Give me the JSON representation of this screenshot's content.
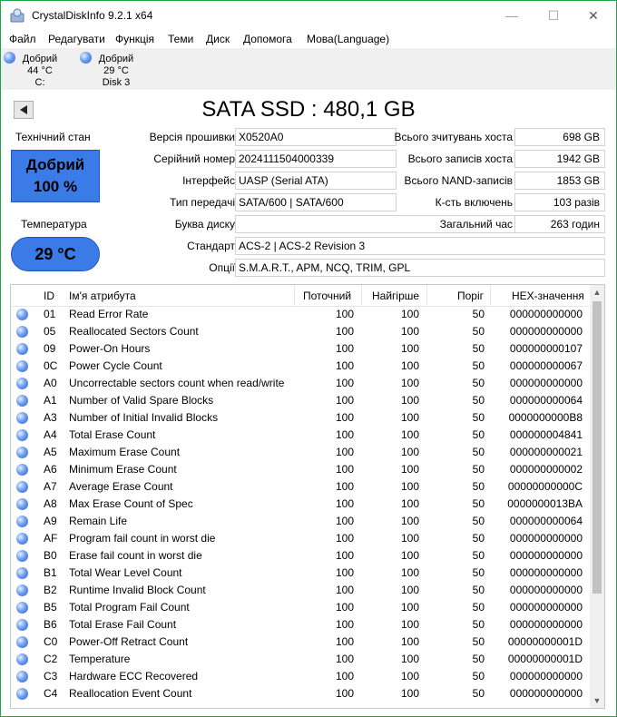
{
  "window": {
    "title": "CrystalDiskInfo 9.2.1 x64",
    "controls": [
      "—",
      "☐",
      "✕"
    ]
  },
  "menu": [
    "Файл",
    "Редагувати",
    "Функція",
    "Теми",
    "Диск",
    "Допомога",
    "Мова(Language)"
  ],
  "disk_tabs": [
    {
      "status": "Добрий",
      "temp": "44 °C",
      "name": "C:"
    },
    {
      "status": "Добрий",
      "temp": "29 °C",
      "name": "Disk 3"
    }
  ],
  "disk_title": "SATA SSD : 480,1 GB",
  "health": {
    "label": "Технічний стан",
    "status": "Добрий",
    "percent": "100 %",
    "color": "#3b7be8"
  },
  "temperature": {
    "label": "Температура",
    "value": "29 °C"
  },
  "info_left": {
    "firmware": {
      "label": "Версія прошивки",
      "value": "X0520A0"
    },
    "serial": {
      "label": "Серійний номер",
      "value": "2024111504000339"
    },
    "interface": {
      "label": "Інтерфейс",
      "value": "UASP (Serial ATA)"
    },
    "transfer": {
      "label": "Тип передачі",
      "value": "SATA/600 | SATA/600"
    },
    "drive_letter": {
      "label": "Буква диску",
      "value": ""
    },
    "standard": {
      "label": "Стандарт",
      "value": "ACS-2 | ACS-2 Revision 3"
    },
    "features": {
      "label": "Опції",
      "value": "S.M.A.R.T., APM, NCQ, TRIM, GPL"
    }
  },
  "info_right": {
    "host_reads": {
      "label": "Всього зчитувань хоста",
      "value": "698 GB"
    },
    "host_writes": {
      "label": "Всього записів хоста",
      "value": "1942 GB"
    },
    "nand_writes": {
      "label": "Всього NAND-записів",
      "value": "1853 GB"
    },
    "power_on_count": {
      "label": "К-сть включень",
      "value": "103 разів"
    },
    "power_on_hours": {
      "label": "Загальний час",
      "value": "263 годин"
    }
  },
  "smart_table": {
    "headers": {
      "id": "ID",
      "name": "Ім'я атрибута",
      "current": "Поточний",
      "worst": "Найгірше",
      "threshold": "Поріг",
      "raw": "HEX-значення"
    },
    "rows": [
      {
        "id": "01",
        "name": "Read Error Rate",
        "current": "100",
        "worst": "100",
        "threshold": "50",
        "raw": "000000000000"
      },
      {
        "id": "05",
        "name": "Reallocated Sectors Count",
        "current": "100",
        "worst": "100",
        "threshold": "50",
        "raw": "000000000000"
      },
      {
        "id": "09",
        "name": "Power-On Hours",
        "current": "100",
        "worst": "100",
        "threshold": "50",
        "raw": "000000000107"
      },
      {
        "id": "0C",
        "name": "Power Cycle Count",
        "current": "100",
        "worst": "100",
        "threshold": "50",
        "raw": "000000000067"
      },
      {
        "id": "A0",
        "name": "Uncorrectable sectors count when read/write",
        "current": "100",
        "worst": "100",
        "threshold": "50",
        "raw": "000000000000"
      },
      {
        "id": "A1",
        "name": "Number of Valid Spare Blocks",
        "current": "100",
        "worst": "100",
        "threshold": "50",
        "raw": "000000000064"
      },
      {
        "id": "A3",
        "name": "Number of Initial Invalid Blocks",
        "current": "100",
        "worst": "100",
        "threshold": "50",
        "raw": "0000000000B8"
      },
      {
        "id": "A4",
        "name": "Total Erase Count",
        "current": "100",
        "worst": "100",
        "threshold": "50",
        "raw": "000000004841"
      },
      {
        "id": "A5",
        "name": "Maximum Erase Count",
        "current": "100",
        "worst": "100",
        "threshold": "50",
        "raw": "000000000021"
      },
      {
        "id": "A6",
        "name": "Minimum Erase Count",
        "current": "100",
        "worst": "100",
        "threshold": "50",
        "raw": "000000000002"
      },
      {
        "id": "A7",
        "name": "Average Erase Count",
        "current": "100",
        "worst": "100",
        "threshold": "50",
        "raw": "00000000000C"
      },
      {
        "id": "A8",
        "name": "Max Erase Count of Spec",
        "current": "100",
        "worst": "100",
        "threshold": "50",
        "raw": "0000000013BA"
      },
      {
        "id": "A9",
        "name": "Remain Life",
        "current": "100",
        "worst": "100",
        "threshold": "50",
        "raw": "000000000064"
      },
      {
        "id": "AF",
        "name": "Program fail count in worst die",
        "current": "100",
        "worst": "100",
        "threshold": "50",
        "raw": "000000000000"
      },
      {
        "id": "B0",
        "name": "Erase fail count in worst die",
        "current": "100",
        "worst": "100",
        "threshold": "50",
        "raw": "000000000000"
      },
      {
        "id": "B1",
        "name": "Total Wear Level Count",
        "current": "100",
        "worst": "100",
        "threshold": "50",
        "raw": "000000000000"
      },
      {
        "id": "B2",
        "name": "Runtime Invalid Block Count",
        "current": "100",
        "worst": "100",
        "threshold": "50",
        "raw": "000000000000"
      },
      {
        "id": "B5",
        "name": "Total Program Fail Count",
        "current": "100",
        "worst": "100",
        "threshold": "50",
        "raw": "000000000000"
      },
      {
        "id": "B6",
        "name": "Total Erase Fail Count",
        "current": "100",
        "worst": "100",
        "threshold": "50",
        "raw": "000000000000"
      },
      {
        "id": "C0",
        "name": "Power-Off Retract Count",
        "current": "100",
        "worst": "100",
        "threshold": "50",
        "raw": "00000000001D"
      },
      {
        "id": "C2",
        "name": "Temperature",
        "current": "100",
        "worst": "100",
        "threshold": "50",
        "raw": "00000000001D"
      },
      {
        "id": "C3",
        "name": "Hardware ECC Recovered",
        "current": "100",
        "worst": "100",
        "threshold": "50",
        "raw": "000000000000"
      },
      {
        "id": "C4",
        "name": "Reallocation Event Count",
        "current": "100",
        "worst": "100",
        "threshold": "50",
        "raw": "000000000000"
      }
    ]
  }
}
